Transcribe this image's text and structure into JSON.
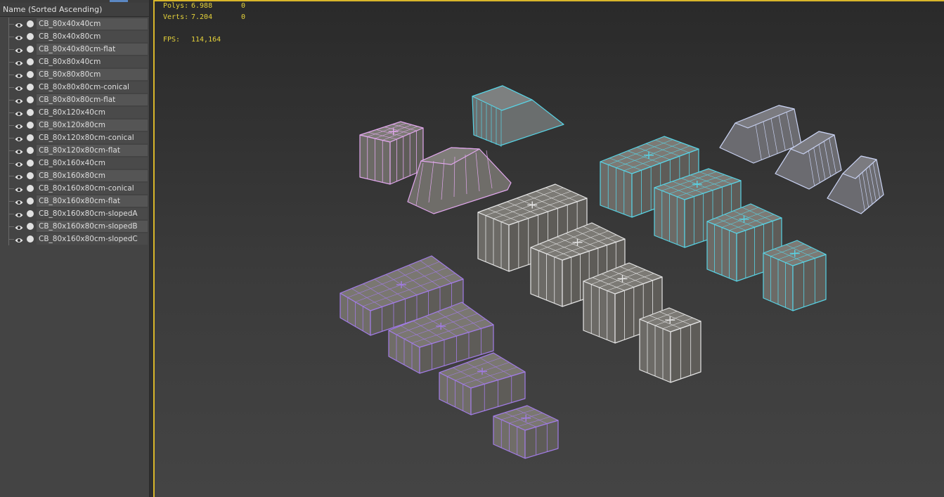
{
  "explorer": {
    "header": "Name (Sorted Ascending)",
    "items": [
      "CB_80x40x40cm",
      "CB_80x40x80cm",
      "CB_80x40x80cm-flat",
      "CB_80x80x40cm",
      "CB_80x80x80cm",
      "CB_80x80x80cm-conical",
      "CB_80x80x80cm-flat",
      "CB_80x120x40cm",
      "CB_80x120x80cm",
      "CB_80x120x80cm-conical",
      "CB_80x120x80cm-flat",
      "CB_80x160x40cm",
      "CB_80x160x80cm",
      "CB_80x160x80cm-conical",
      "CB_80x160x80cm-flat",
      "CB_80x160x80cm-slopedA",
      "CB_80x160x80cm-slopedB",
      "CB_80x160x80cm-slopedC"
    ]
  },
  "viewport": {
    "stats": {
      "polys_label": "Polys:",
      "polys_total": "6.988",
      "polys_sel": "0",
      "verts_label": "Verts:",
      "verts_total": "7.204",
      "verts_sel": "0",
      "fps_label": "FPS:",
      "fps_value": "114,164"
    }
  },
  "colors": {
    "accent_border": "#d8b62a",
    "wire_pink": "#e2a8ee",
    "wire_cyan": "#58d4e6",
    "wire_purple": "#a27ce6",
    "stat_text": "#e5d23a",
    "block_fill": "#6f6d69"
  },
  "icons": [
    "eye-icon",
    "render-dot-icon"
  ]
}
